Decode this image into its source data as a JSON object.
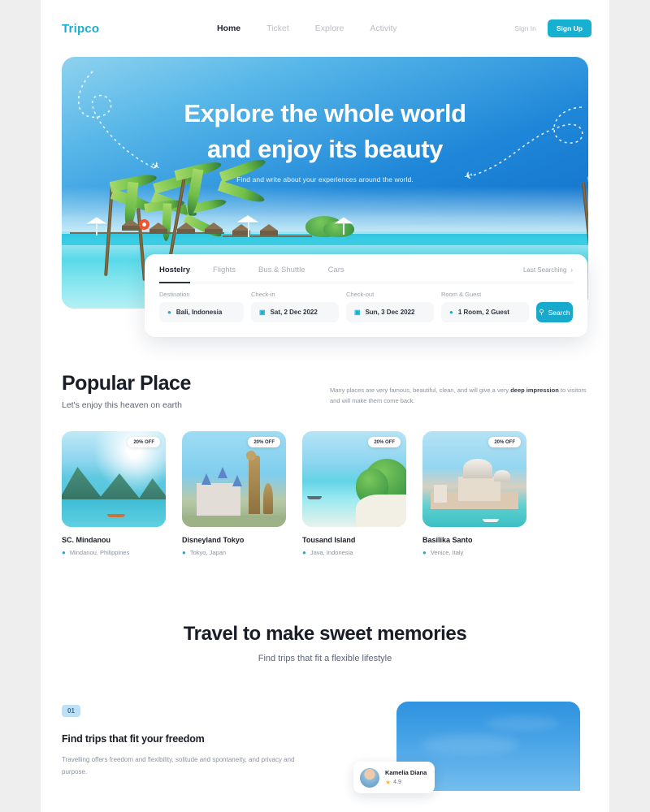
{
  "brand": {
    "name": "Tripco"
  },
  "nav": {
    "items": [
      {
        "label": "Home",
        "active": true
      },
      {
        "label": "Ticket",
        "active": false
      },
      {
        "label": "Explore",
        "active": false
      },
      {
        "label": "Activity",
        "active": false
      }
    ],
    "sign_in": "Sign In",
    "sign_up": "Sign Up"
  },
  "hero": {
    "title_line1": "Explore the whole world",
    "title_line2": "and enjoy its beauty",
    "subtitle": "Find and write about your experiences around the world."
  },
  "search": {
    "tabs": [
      {
        "label": "Hostelry",
        "active": true
      },
      {
        "label": "Flights",
        "active": false
      },
      {
        "label": "Bus & Shuttle",
        "active": false
      },
      {
        "label": "Cars",
        "active": false
      }
    ],
    "last_searching": "Last Searching",
    "chevron": "›",
    "fields": [
      {
        "label": "Destination",
        "value": "Bali, Indonesia",
        "icon": "location-pin-icon"
      },
      {
        "label": "Check-in",
        "value": "Sat, 2 Dec 2022",
        "icon": "calendar-icon"
      },
      {
        "label": "Check-out",
        "value": "Sun, 3 Dec 2022",
        "icon": "calendar-icon"
      },
      {
        "label": "Room & Guest",
        "value": "1 Room, 2 Guest",
        "icon": "person-icon"
      }
    ],
    "button_label": "Search",
    "button_icon": "search-icon"
  },
  "popular": {
    "title": "Popular Place",
    "subtitle": "Let's enjoy this heaven on earth",
    "desc_plain1": "Many places are very famous, beautiful, clean, and will give a very ",
    "desc_bold": "deep impression",
    "desc_plain2": " to visitors and will make them come back.",
    "cards": [
      {
        "badge": "20% OFF",
        "name": "SC. Mindanou",
        "location": "Mindanou, Philippines"
      },
      {
        "badge": "20% OFF",
        "name": "Disneyland Tokyo",
        "location": "Tokyo, Japan"
      },
      {
        "badge": "20% OFF",
        "name": "Tousand Island",
        "location": "Java, Indonesia"
      },
      {
        "badge": "20% OFF",
        "name": "Basilika Santo",
        "location": "Venice, Italy"
      }
    ]
  },
  "travel": {
    "title": "Travel to make sweet memories",
    "subtitle": "Find trips that fit a flexible lifestyle"
  },
  "feature": {
    "number": "01",
    "title": "Find trips that fit your freedom",
    "description": "Travelling offers freedom and flexibility, solitude and spontaneity, and privacy and purpose."
  },
  "reviewer": {
    "name": "Kamelia Diana",
    "rating": "4.9",
    "star": "★"
  },
  "colors": {
    "accent": "#17b0d0",
    "button": "#17aacd",
    "badge_bg": "#bfe0f2",
    "badge_text": "#2d6fa0",
    "star": "#f6b93b",
    "text_dark": "#191d28",
    "text_muted": "#8b929e"
  }
}
